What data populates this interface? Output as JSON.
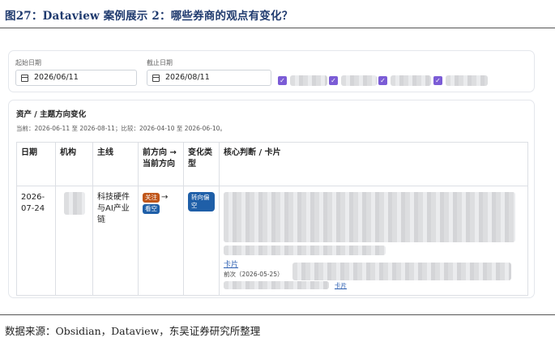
{
  "figure": {
    "title": "图27：Dataview 案例展示 2：哪些券商的观点有变化？",
    "source": "数据来源：Obsidian，Dataview，东吴证券研究所整理"
  },
  "filters": {
    "start_label": "起始日期",
    "start_value": "2026/06/11",
    "end_label": "截止日期",
    "end_value": "2026/08/11",
    "checkbox_glyph": "✓"
  },
  "card": {
    "title": "资产 / 主题方向变化",
    "subtitle": "当前：2026-06-11 至 2026-08-11；比较：2026-04-10 至 2026-06-10。",
    "columns": [
      "日期",
      "机构",
      "主线",
      "前方向 → 当前方向",
      "变化类型",
      "核心判断 / 卡片"
    ],
    "rows": [
      {
        "date": "2026-07-24",
        "mainline": "科技硬件与AI产业链",
        "prev_badge": "关注",
        "arrow": "→",
        "curr_badge": "看空",
        "change": "转向偏空",
        "card_link": "卡片",
        "prev_label": "前次（2026-05-25）",
        "card_link_2": "卡片"
      }
    ]
  }
}
